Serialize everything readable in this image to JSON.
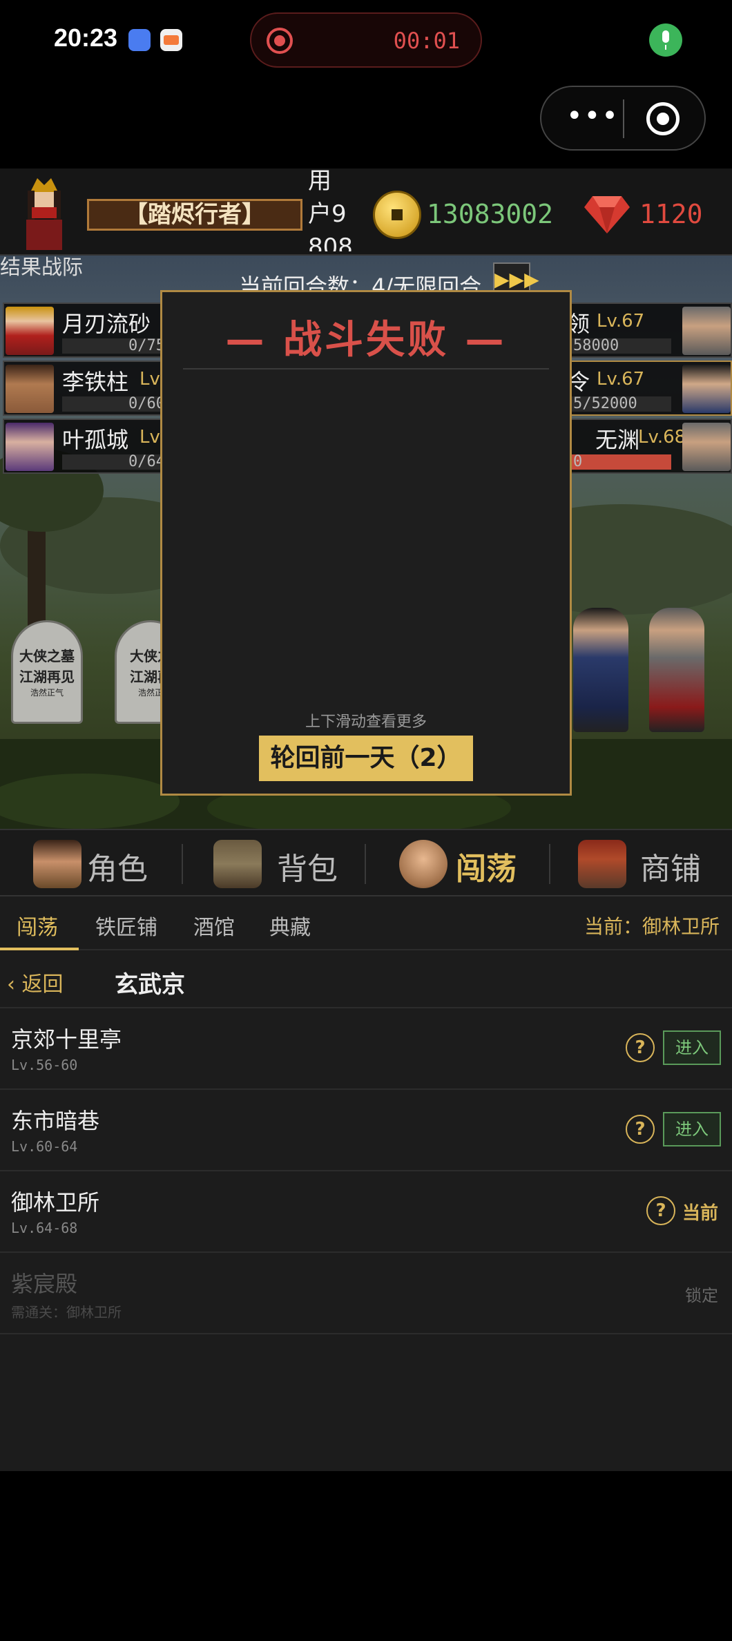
{
  "status_bar": {
    "time": "20:23",
    "recording_time": "00:01"
  },
  "capsule": {
    "more_label": "•••"
  },
  "player": {
    "title": "【踏烬行者】",
    "username": "用\n户9\n808",
    "coins": "13083002",
    "gems": "1120"
  },
  "battle": {
    "title": "结果战际",
    "round_info": "当前回合数：4/无限回合",
    "fast_forward": "▶▶▶",
    "allies": [
      {
        "name": "月刃流砂",
        "level": "",
        "hp": "0/75"
      },
      {
        "name": "李铁柱",
        "level": "Lv.",
        "hp": "0/60"
      },
      {
        "name": "叶孤城",
        "level": "Lv.",
        "hp": "0/64"
      }
    ],
    "enemies": [
      {
        "name": "领",
        "level": "Lv.67",
        "hp": "58000"
      },
      {
        "name": "令",
        "level": "Lv.67",
        "hp": "5/52000"
      },
      {
        "name": "无渊",
        "level": "Lv.68",
        "hp": "0"
      }
    ],
    "tombs": [
      {
        "line1": "大侠之墓",
        "line2": "江湖再见",
        "line3": "浩然正气"
      },
      {
        "line1": "大侠之",
        "line2": "江湖再",
        "line3": "浩然正"
      }
    ]
  },
  "modal": {
    "title": "— 战斗失败 —",
    "hint": "上下滑动查看更多",
    "button": "轮回前一天（2）"
  },
  "main_tabs": [
    {
      "label": "角色",
      "icon": "character-icon",
      "active": false
    },
    {
      "label": "背包",
      "icon": "backpack-icon",
      "active": false
    },
    {
      "label": "闯荡",
      "icon": "fist-icon",
      "active": true
    },
    {
      "label": "商铺",
      "icon": "shop-icon",
      "active": false
    }
  ],
  "sub_tabs": [
    {
      "label": "闯荡",
      "active": true
    },
    {
      "label": "铁匠铺",
      "active": false
    },
    {
      "label": "酒馆",
      "active": false
    },
    {
      "label": "典藏",
      "active": false
    }
  ],
  "current_location": "当前：御林卫所",
  "content": {
    "back_label": "返回",
    "region": "玄武京",
    "locations": [
      {
        "name": "京郊十里亭",
        "level": "Lv.56-60",
        "action": "进入"
      },
      {
        "name": "东市暗巷",
        "level": "Lv.60-64",
        "action": "进入"
      },
      {
        "name": "御林卫所",
        "level": "Lv.64-68",
        "action": "当前"
      },
      {
        "name": "紫宸殿",
        "level": "需通关：御林卫所",
        "action": "锁定"
      }
    ]
  },
  "colors": {
    "gold": "#e2bf5e",
    "red": "#d9514a",
    "green": "#7cc77a"
  }
}
